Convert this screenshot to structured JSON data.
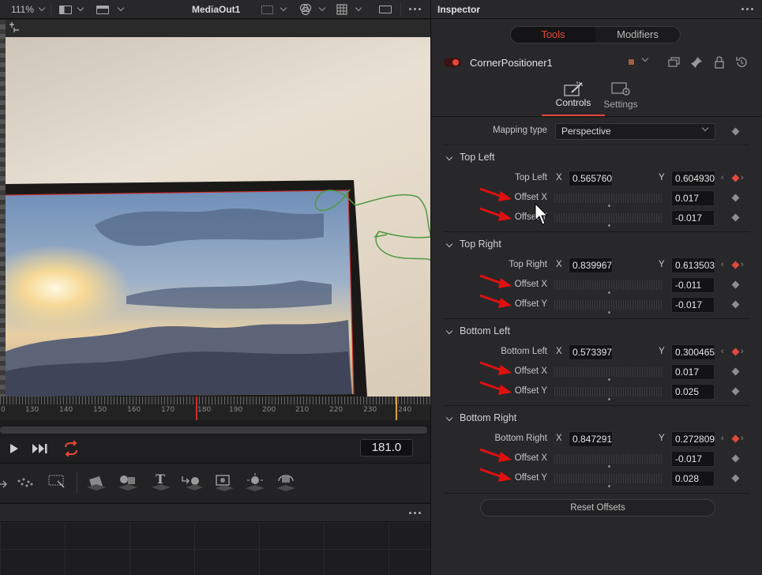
{
  "viewer": {
    "zoom": "111%",
    "title": "MediaOut1",
    "timeline_ticks": [
      "0",
      "130",
      "140",
      "150",
      "160",
      "170",
      "180",
      "190",
      "200",
      "210",
      "220",
      "230",
      "240"
    ],
    "current_frame": "181.0"
  },
  "inspector": {
    "title": "Inspector",
    "tabs": [
      "Tools",
      "Modifiers"
    ],
    "node_name": "CornerPositioner1",
    "node_color": "#a06246",
    "control_tabs": [
      "Controls",
      "Settings"
    ],
    "mapping_type_label": "Mapping type",
    "mapping_type_value": "Perspective",
    "sections": [
      {
        "title": "Top Left",
        "point_label": "Top Left",
        "x": "0.565760",
        "y": "0.604930",
        "offset_x_label": "Offset X",
        "offset_x": "0.017",
        "offset_y_label": "Offset Y",
        "offset_y": "-0.017"
      },
      {
        "title": "Top Right",
        "point_label": "Top Right",
        "x": "0.839967",
        "y": "0.613503",
        "offset_x_label": "Offset X",
        "offset_x": "-0.011",
        "offset_y_label": "Offset Y",
        "offset_y": "-0.017"
      },
      {
        "title": "Bottom Left",
        "point_label": "Bottom Left",
        "x": "0.573397",
        "y": "0.300465",
        "offset_x_label": "Offset X",
        "offset_x": "0.017",
        "offset_y_label": "Offset Y",
        "offset_y": "0.025"
      },
      {
        "title": "Bottom Right",
        "point_label": "Bottom Right",
        "x": "0.847291",
        "y": "0.272809",
        "offset_x_label": "Offset X",
        "offset_x": "-0.017",
        "offset_y_label": "Offset Y",
        "offset_y": "0.028"
      }
    ],
    "axis_x": "X",
    "axis_y": "Y",
    "reset_label": "Reset Offsets"
  },
  "colors": {
    "accent": "#e5483a",
    "annotation_arrow": "#e01010"
  }
}
